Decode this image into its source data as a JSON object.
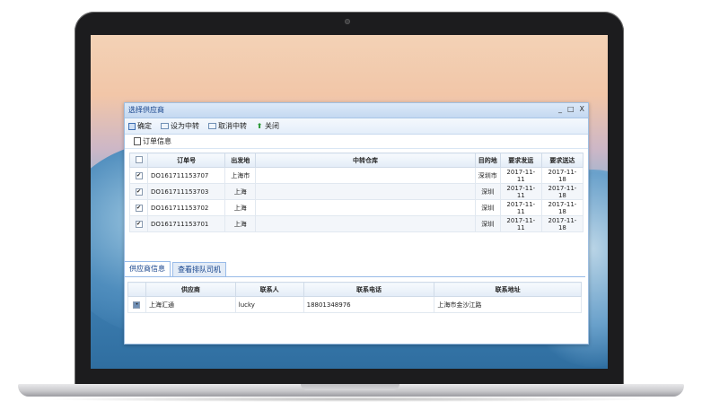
{
  "window": {
    "title": "选择供应商",
    "controls": [
      "_",
      "□",
      "X"
    ]
  },
  "toolbar": {
    "confirm": "确定",
    "set_transfer": "设为中转",
    "cancel_transfer": "取消中转",
    "close": "关闭"
  },
  "order_section": {
    "title": "订单信息",
    "columns": [
      "订单号",
      "出发地",
      "中转仓库",
      "目的地",
      "要求发运",
      "要求送达"
    ],
    "rows": [
      {
        "checked": true,
        "order_no": "DO161711153707",
        "origin": "上海市",
        "warehouse": "",
        "destination": "深圳市",
        "ship_date": "2017-11-11",
        "deliver_date": "2017-11-18"
      },
      {
        "checked": true,
        "order_no": "DO161711153703",
        "origin": "上海",
        "warehouse": "",
        "destination": "深圳",
        "ship_date": "2017-11-11",
        "deliver_date": "2017-11-18"
      },
      {
        "checked": true,
        "order_no": "DO161711153702",
        "origin": "上海",
        "warehouse": "",
        "destination": "深圳",
        "ship_date": "2017-11-11",
        "deliver_date": "2017-11-18"
      },
      {
        "checked": true,
        "order_no": "DO161711153701",
        "origin": "上海",
        "warehouse": "",
        "destination": "深圳",
        "ship_date": "2017-11-11",
        "deliver_date": "2017-11-18"
      }
    ]
  },
  "tabs": [
    "供应商信息",
    "查看排队司机"
  ],
  "supplier_section": {
    "columns": [
      "供应商",
      "联系人",
      "联系电话",
      "联系地址"
    ],
    "rows": [
      {
        "selected": true,
        "name": "上海汇通",
        "contact": "lucky",
        "phone": "18801348976",
        "address": "上海市金沙江路"
      }
    ]
  },
  "colors": {
    "title_text": "#15428b",
    "border": "#99bbe8",
    "header_bg": "#c4d9f1"
  }
}
